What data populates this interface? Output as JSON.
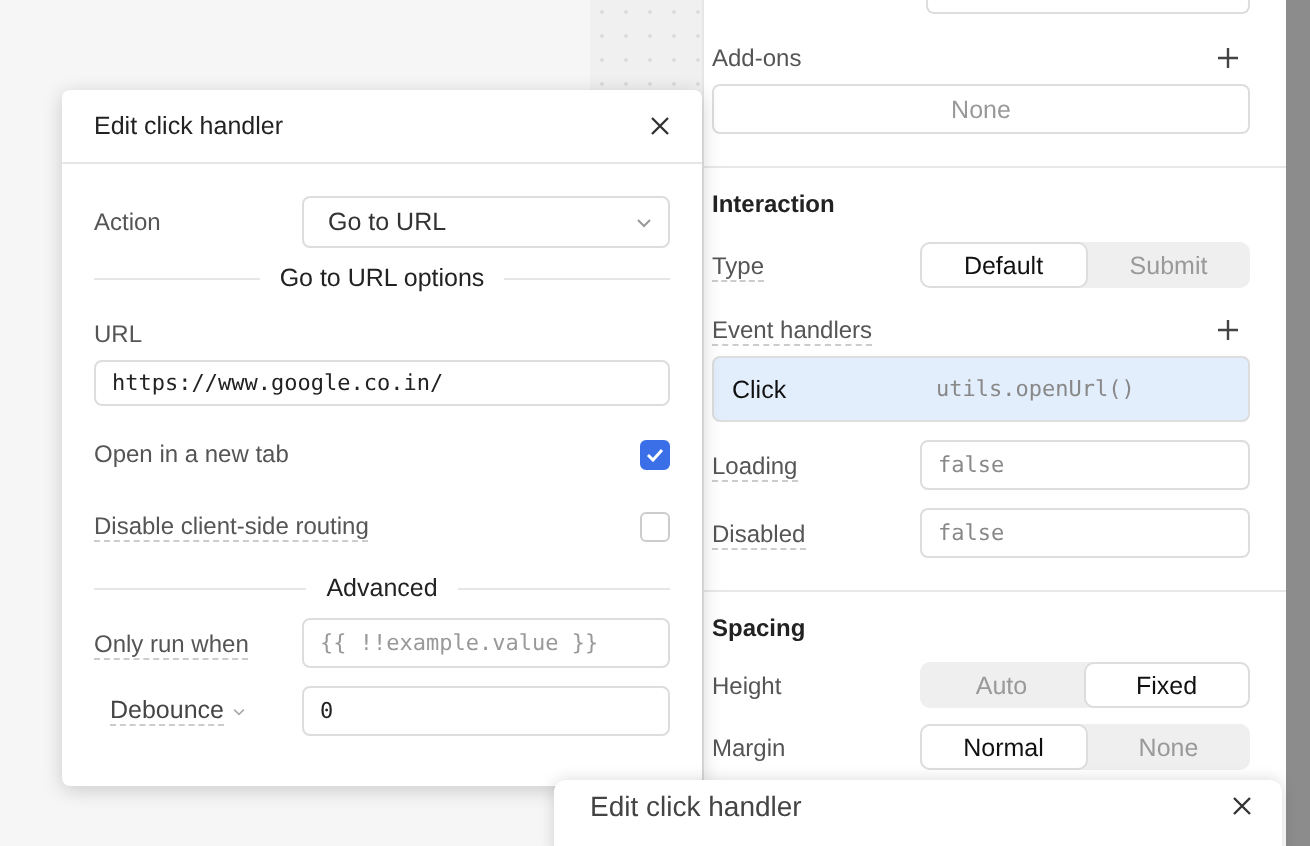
{
  "panel": {
    "addons": {
      "label": "Add-ons",
      "value": "None"
    },
    "interaction": {
      "title": "Interaction",
      "type": {
        "label": "Type",
        "options": [
          {
            "label": "Default",
            "selected": true
          },
          {
            "label": "Submit",
            "selected": false
          }
        ]
      },
      "event_handlers": {
        "label": "Event handlers",
        "items": [
          {
            "event": "Click",
            "action": "utils.openUrl()",
            "selected": true
          }
        ]
      },
      "fields": [
        {
          "label": "Loading",
          "placeholder": "false"
        },
        {
          "label": "Disabled",
          "placeholder": "false"
        }
      ]
    },
    "spacing": {
      "title": "Spacing",
      "rows": [
        {
          "label": "Height",
          "options": [
            {
              "label": "Auto",
              "selected": false
            },
            {
              "label": "Fixed",
              "selected": true
            }
          ]
        },
        {
          "label": "Margin",
          "options": [
            {
              "label": "Normal",
              "selected": true
            },
            {
              "label": "None",
              "selected": false
            }
          ]
        }
      ]
    }
  },
  "dialog": {
    "title": "Edit click handler",
    "action": {
      "label": "Action",
      "value": "Go to URL"
    },
    "options_title": "Go to URL options",
    "url": {
      "label": "URL",
      "value": "https://www.google.co.in/"
    },
    "toggles": [
      {
        "label": "Open in a new tab",
        "checked": true
      },
      {
        "label": "Disable client-side routing",
        "checked": false
      }
    ],
    "advanced_title": "Advanced",
    "only_run_when": {
      "label": "Only run when",
      "placeholder": "{{ !!example.value }}"
    },
    "debounce": {
      "label": "Debounce",
      "value": "0"
    }
  },
  "dialog_2": {
    "title": "Edit click handler"
  }
}
